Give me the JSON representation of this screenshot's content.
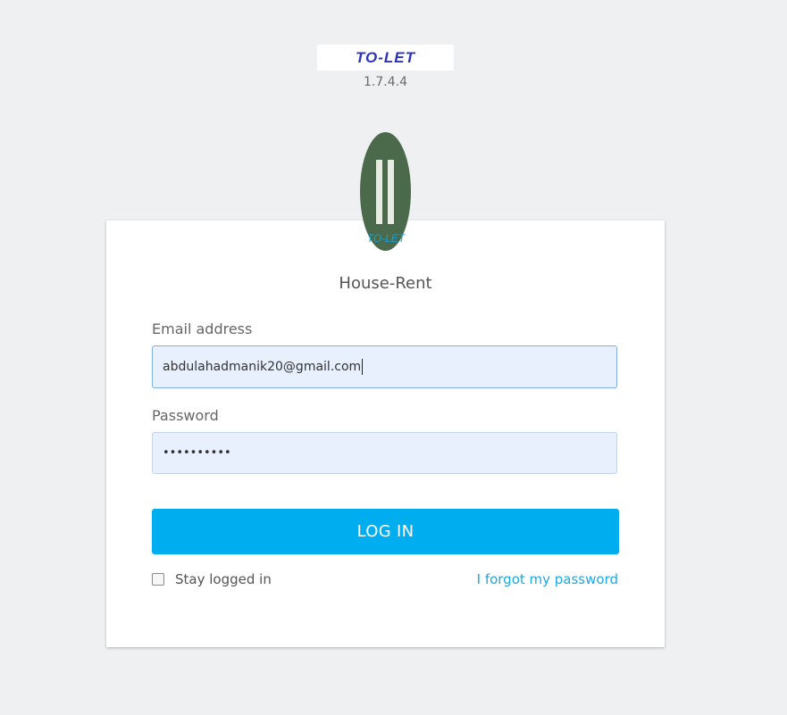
{
  "brand": {
    "logo_text": "TO-LET",
    "version": "1.7.4.4"
  },
  "app_logo": {
    "text": "TO-LET",
    "colors": {
      "background": "#4a6a4b",
      "bars": "#e6ece2",
      "text": "#1a9fd6"
    }
  },
  "login": {
    "app_name": "House-Rent",
    "email_label": "Email address",
    "email_value": "abdulahadmanik20@gmail.com",
    "password_label": "Password",
    "password_value": "••••••••••",
    "login_button": "LOG IN",
    "stay_logged_in_label": "Stay logged in",
    "stay_logged_in_checked": false,
    "forgot_password_label": "I forgot my password"
  },
  "colors": {
    "accent": "#00aeef",
    "link": "#1ca8e3",
    "background": "#eff0f2",
    "input_fill": "#e8f0fd"
  }
}
